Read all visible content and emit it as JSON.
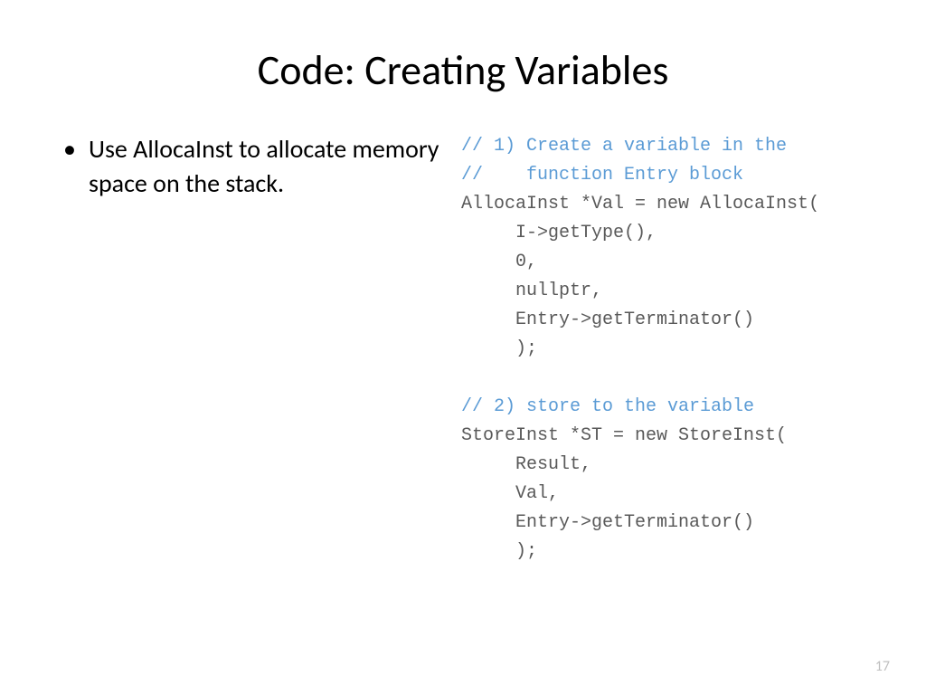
{
  "title": "Code: Creating Variables",
  "bullet1": "Use AllocaInst to allocate memory space on the stack.",
  "code": {
    "c1a": "// 1) Create a variable in the",
    "c1b": "//    function Entry block",
    "l1": "AllocaInst *Val = new AllocaInst(",
    "l2": "     I->getType(),",
    "l3": "     0,",
    "l4": "     nullptr,",
    "l5": "     Entry->getTerminator()",
    "l6": "     );",
    "blank": "",
    "c2": "// 2) store to the variable",
    "l7": "StoreInst *ST = new StoreInst(",
    "l8": "     Result,",
    "l9": "     Val,",
    "l10": "     Entry->getTerminator()",
    "l11": "     );"
  },
  "page": "17"
}
